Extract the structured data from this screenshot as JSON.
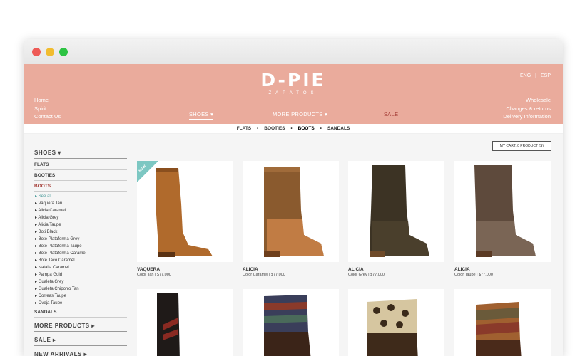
{
  "site": {
    "logo_main": "D-PIE",
    "logo_sub": "ZAPATOS",
    "lang": [
      "ENG",
      "|",
      "ESP"
    ],
    "nav_left": [
      "Home",
      "Spirit",
      "Contact Us"
    ],
    "nav_right": [
      "Wholesale",
      "Changes & returns",
      "Delivery Information"
    ],
    "nav_center": {
      "shoes": "SHOES ▾",
      "more": "MORE PRODUCTS ▾",
      "sale": "SALE"
    },
    "subnav": [
      "FLATS",
      "BOOTIES",
      "BOOTS",
      "SANDALS"
    ]
  },
  "sidebar": {
    "heading": "SHOES ▾",
    "categories": [
      "FLATS",
      "BOOTIES",
      "BOOTS"
    ],
    "items": [
      "▸ See all",
      "▸ Vaquera Tan",
      "▸ Alicia Caramel",
      "▸ Alicia Grey",
      "▸ Alicia Taupe",
      "▸ Boti Black",
      "▸ Bote Plataforma Grey",
      "▸ Bote Plataforma Taupe",
      "▸ Bote Plataforma Caramel",
      "▸ Bote Taco Caramel",
      "▸ Natalia Caramel",
      "▸ Pampa Gold",
      "▸ Gualeta Grey",
      "▸ Gualeta Chiporro Tan",
      "▸ Correas Taupe",
      "▸ Oveja Taupe"
    ],
    "sandals": "SANDALS",
    "more": "MORE PRODUCTS ▸",
    "sale": "SALE ▸",
    "new_arrivals": "NEW ARRIVALS ▸"
  },
  "cart": "MY CART: 0 PRODUCT (S)",
  "badge": "NEW",
  "products": [
    {
      "name": "VAQUERA",
      "meta": "Color Tan | $77,000"
    },
    {
      "name": "ALICIA",
      "meta": "Color Caramel | $77,000"
    },
    {
      "name": "ALICIA",
      "meta": "Color Grey | $77,000"
    },
    {
      "name": "ALICIA",
      "meta": "Color Taupe | $77,000"
    }
  ],
  "colors": {
    "header": "#eaab9c",
    "sale": "#a33a34",
    "see_all": "#4a9a9a",
    "badge": "#7cc7c2"
  }
}
